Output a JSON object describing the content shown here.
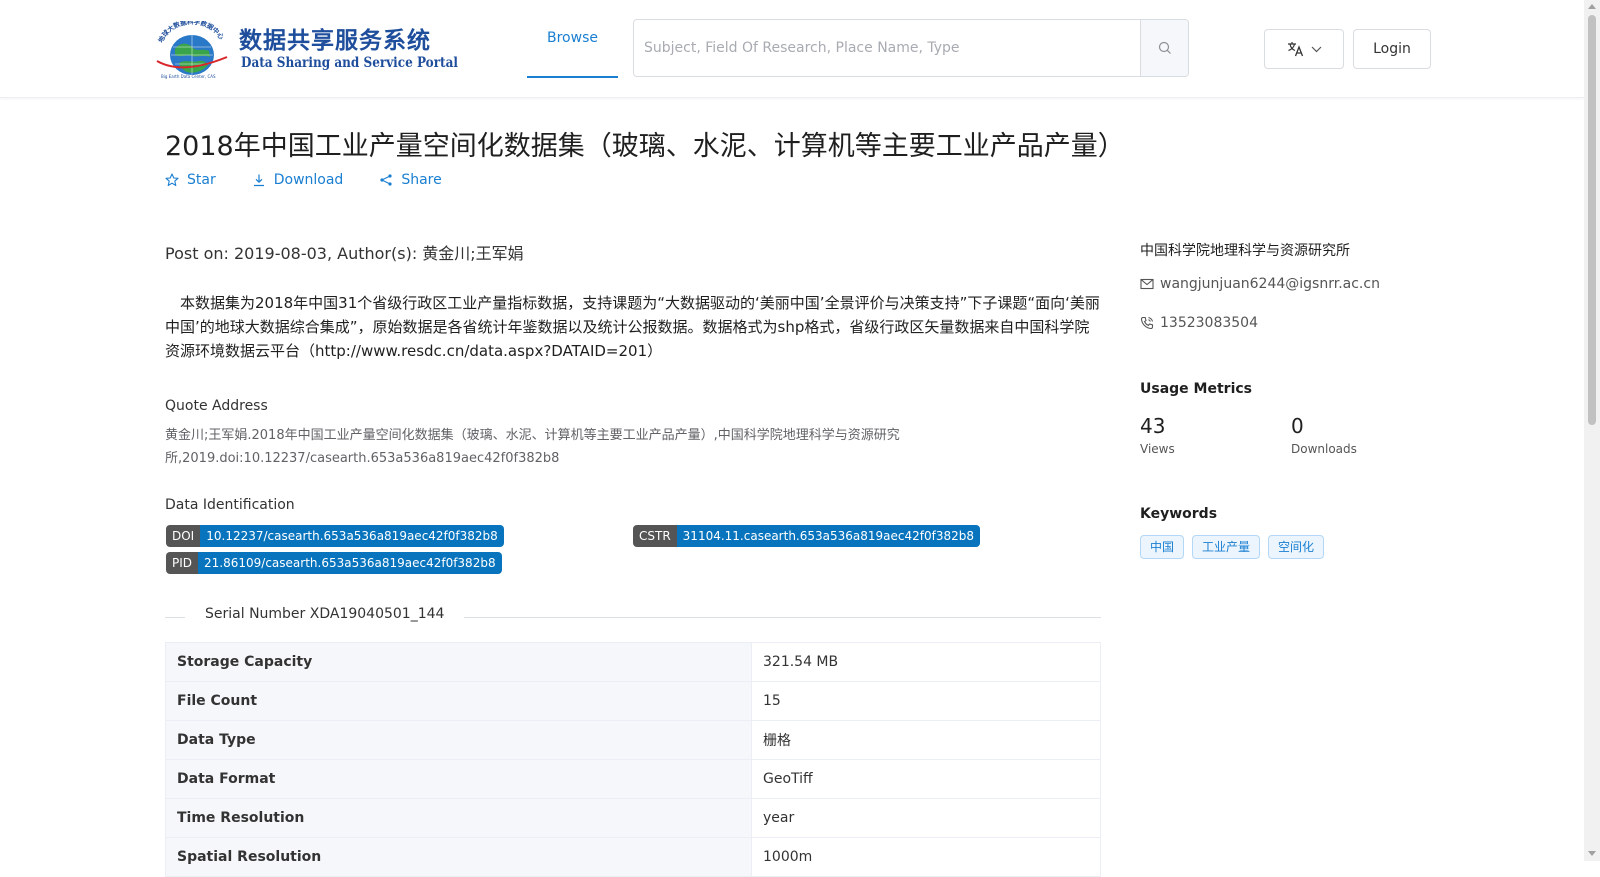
{
  "header": {
    "logo_cn": "数据共享服务系统",
    "logo_en": "Data Sharing and Service Portal",
    "logo_arc_text": "地球大数据科学数据中心",
    "logo_sub": "Big Earth Data Center, CAS",
    "nav_browse": "Browse",
    "search_placeholder": "Subject, Field Of Research, Place Name, Type",
    "login": "Login",
    "colors": {
      "accent": "#1a7fd1",
      "logo_blue": "#1f4e9c"
    }
  },
  "dataset": {
    "title": "2018年中国工业产量空间化数据集（玻璃、水泥、计算机等主要工业产品产量）",
    "actions": {
      "star": "Star",
      "download": "Download",
      "share": "Share"
    },
    "post_line": "Post on: 2019-08-03, Author(s): 黄金川;王军娟",
    "description": "本数据集为2018年中国31个省级行政区工业产量指标数据，支持课题为“大数据驱动的‘美丽中国’全景评价与决策支持”下子课题“面向‘美丽中国’的地球大数据综合集成”，原始数据是各省统计年鉴数据以及统计公报数据。数据格式为shp格式，省级行政区矢量数据来自中国科学院资源环境数据云平台（http://www.resdc.cn/data.aspx?DATAID=201）",
    "quote_label": "Quote Address",
    "quote_text": "黄金川;王军娟.2018年中国工业产量空间化数据集（玻璃、水泥、计算机等主要工业产品产量）,中国科学院地理科学与资源研究所,2019.doi:10.12237/casearth.653a536a819aec42f0f382b8",
    "identification_label": "Data Identification",
    "identifiers": [
      {
        "key": "DOI",
        "value": "10.12237/casearth.653a536a819aec42f0f382b8"
      },
      {
        "key": "CSTR",
        "value": "31104.11.casearth.653a536a819aec42f0f382b8"
      },
      {
        "key": "PID",
        "value": "21.86109/casearth.653a536a819aec42f0f382b8"
      }
    ],
    "serial_number": "Serial Number XDA19040501_144",
    "info_table": [
      {
        "key": "Storage Capacity",
        "value": "321.54 MB"
      },
      {
        "key": "File Count",
        "value": "15"
      },
      {
        "key": "Data Type",
        "value": "栅格"
      },
      {
        "key": "Data Format",
        "value": "GeoTiff"
      },
      {
        "key": "Time Resolution",
        "value": "year"
      },
      {
        "key": "Spatial Resolution",
        "value": "1000m"
      }
    ]
  },
  "sidebar": {
    "organization": "中国科学院地理科学与资源研究所",
    "email": "wangjunjuan6244@igsnrr.ac.cn",
    "phone": "13523083504",
    "usage_title": "Usage Metrics",
    "views_value": "43",
    "views_label": "Views",
    "downloads_value": "0",
    "downloads_label": "Downloads",
    "keywords_title": "Keywords",
    "keywords": [
      "中国",
      "工业产量",
      "空间化"
    ]
  }
}
